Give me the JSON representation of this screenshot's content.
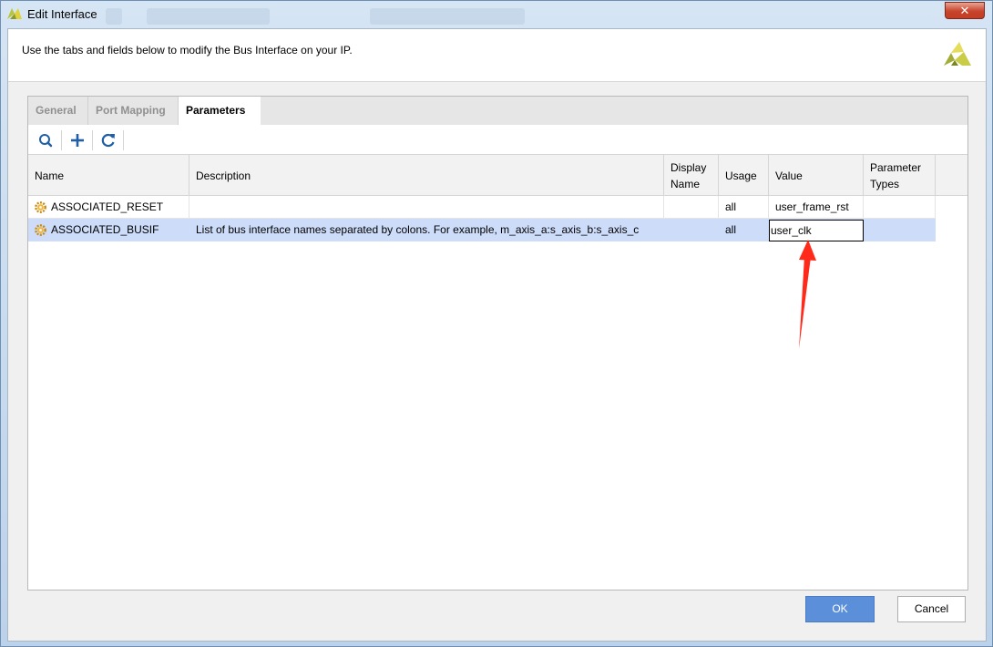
{
  "window": {
    "title": "Edit Interface",
    "close_label": "✕"
  },
  "header": {
    "description": "Use the tabs and fields below to modify the Bus Interface on your IP."
  },
  "tabs": [
    {
      "label": "General",
      "active": false
    },
    {
      "label": "Port Mapping",
      "active": false
    },
    {
      "label": "Parameters",
      "active": true
    }
  ],
  "toolbar": {
    "icons": [
      "search-icon",
      "add-icon",
      "refresh-icon"
    ]
  },
  "table": {
    "columns": [
      "Name",
      "Description",
      "Display Name",
      "Usage",
      "Value",
      "Parameter Types"
    ],
    "rows": [
      {
        "name": "ASSOCIATED_RESET",
        "description": "",
        "display_name": "",
        "usage": "all",
        "value": "user_frame_rst",
        "parameter_types": "",
        "selected": false
      },
      {
        "name": "ASSOCIATED_BUSIF",
        "description": "List of bus interface names separated by colons. For example, m_axis_a:s_axis_b:s_axis_c",
        "display_name": "",
        "usage": "all",
        "value": "user_clk",
        "parameter_types": "",
        "selected": true
      }
    ]
  },
  "buttons": {
    "ok": "OK",
    "cancel": "Cancel"
  },
  "colors": {
    "accent": "#5b8fd9",
    "selection": "#cddcf9",
    "annotation_arrow": "#ff2a1a"
  }
}
